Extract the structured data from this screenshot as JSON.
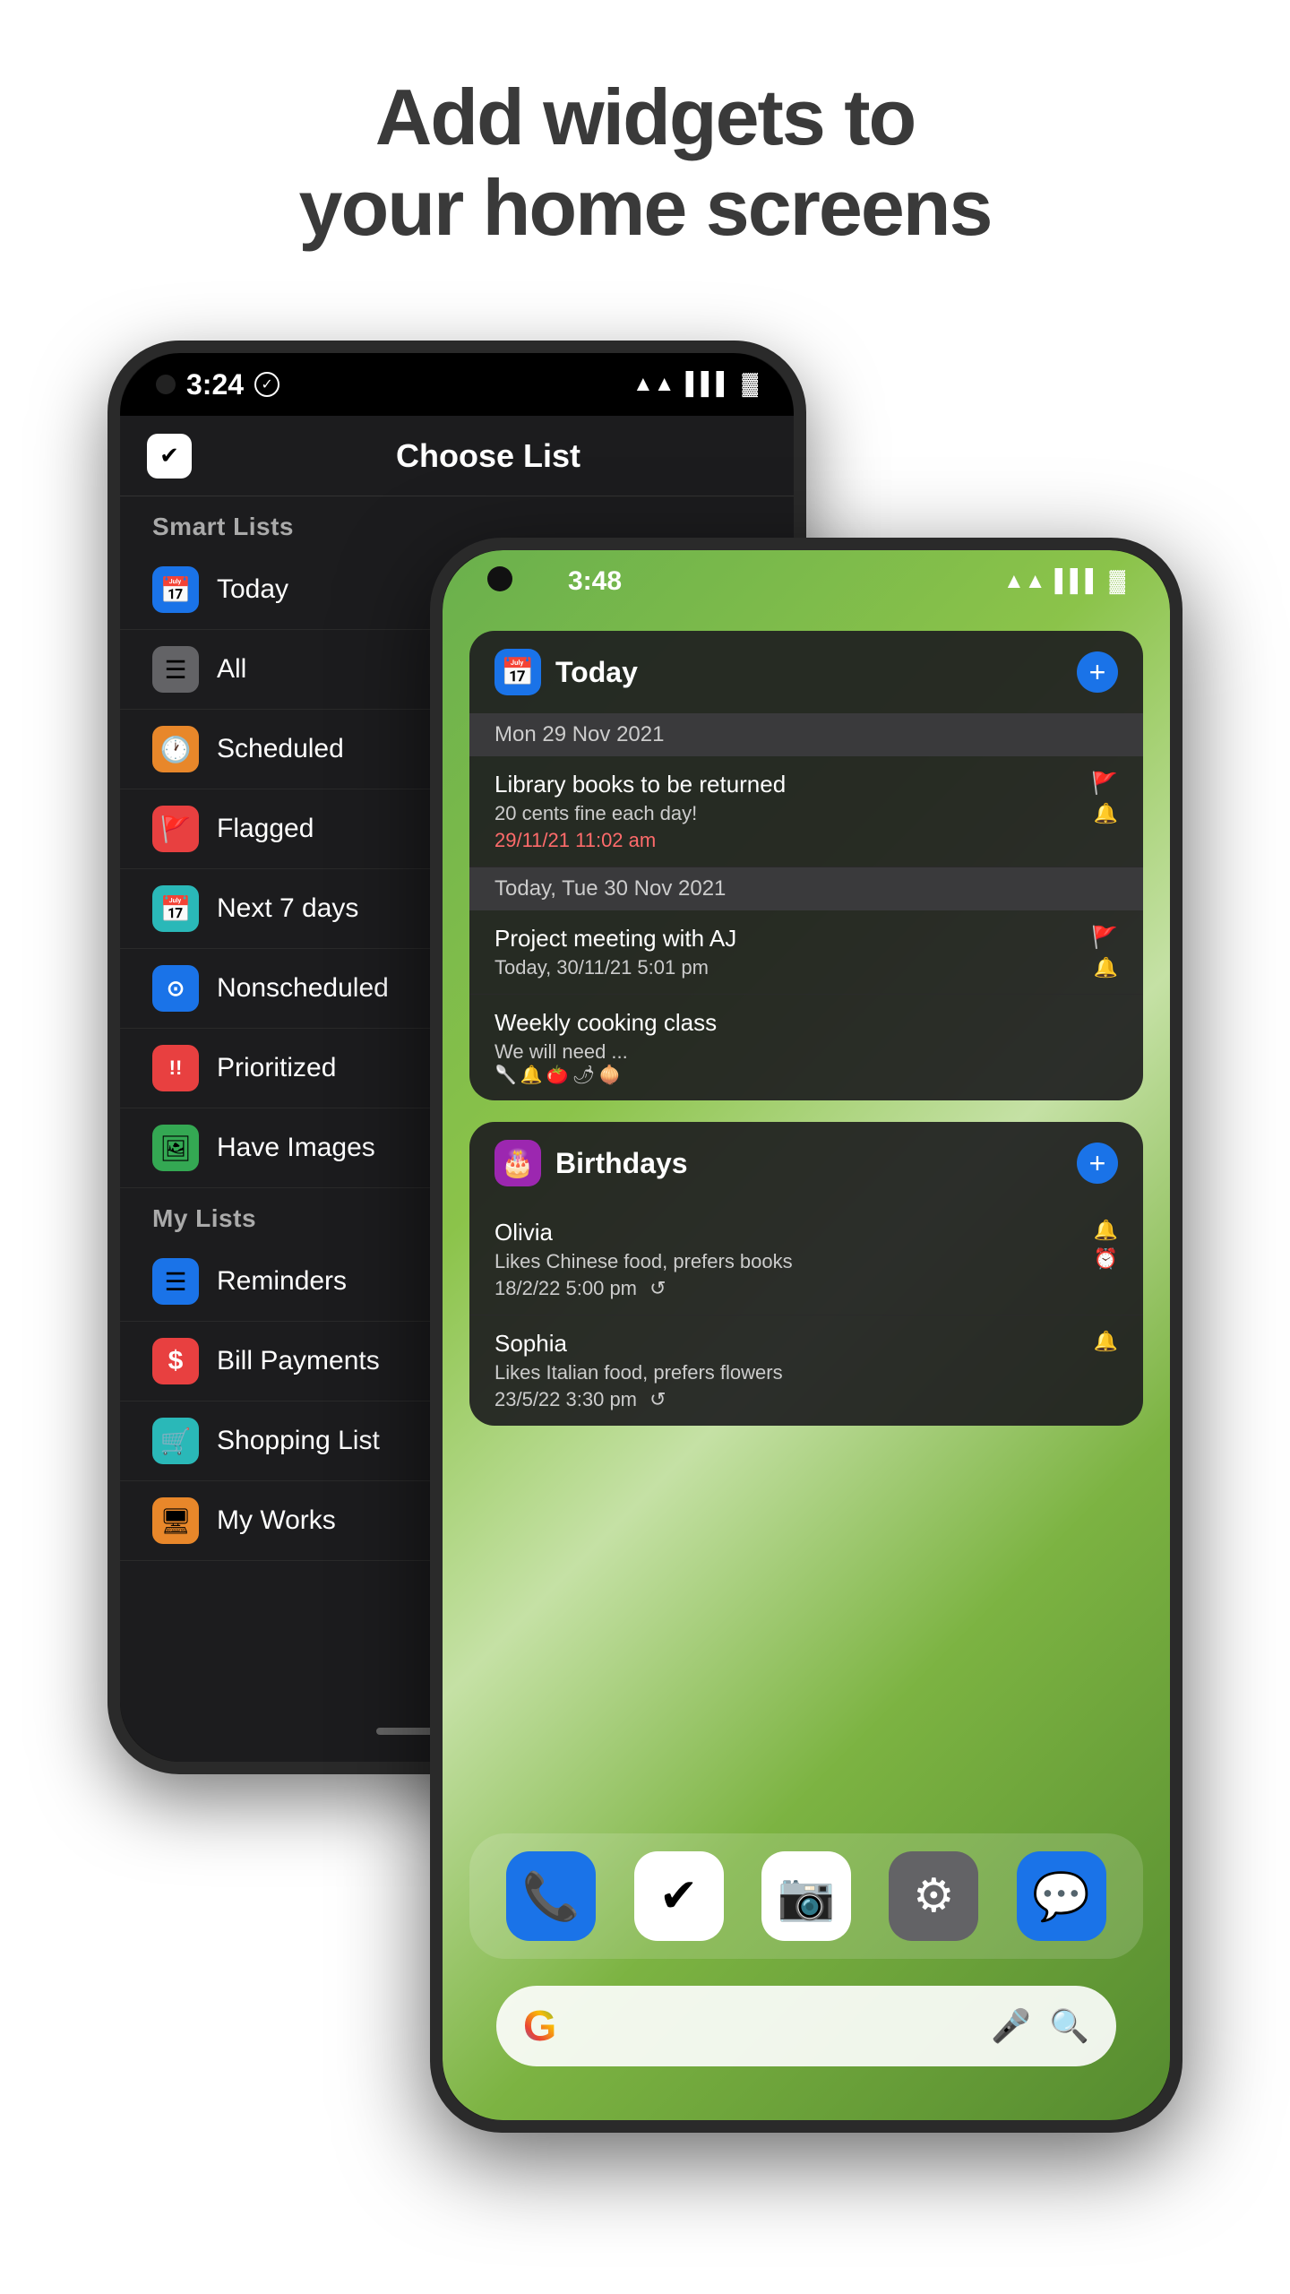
{
  "header": {
    "line1": "Add widgets to",
    "line2": "your home screens"
  },
  "phone_back": {
    "status": {
      "time": "3:24",
      "wifi": "▲",
      "signal": "▌▌▌",
      "battery": "🔋"
    },
    "toolbar_title": "Choose List",
    "smart_lists_header": "Smart Lists",
    "smart_lists": [
      {
        "icon": "📅",
        "icon_color": "icon-blue",
        "label": "Today"
      },
      {
        "icon": "☰",
        "icon_color": "icon-gray",
        "label": "All"
      },
      {
        "icon": "🕐",
        "icon_color": "icon-orange",
        "label": "Scheduled"
      },
      {
        "icon": "🚩",
        "icon_color": "icon-red-flag",
        "label": "Flagged"
      },
      {
        "icon": "📅",
        "icon_color": "icon-teal",
        "label": "Next 7 days"
      },
      {
        "icon": "⊙",
        "icon_color": "icon-blue-circle",
        "label": "Nonscheduled"
      },
      {
        "icon": "!!",
        "icon_color": "icon-red-exclaim",
        "label": "Prioritized"
      },
      {
        "icon": "🖼",
        "icon_color": "icon-green-img",
        "label": "Have Images"
      }
    ],
    "my_lists_header": "My Lists",
    "my_lists": [
      {
        "icon": "☰",
        "icon_color": "icon-blue-lines",
        "label": "Reminders"
      },
      {
        "icon": "$",
        "icon_color": "icon-red-dollar",
        "label": "Bill Payments"
      },
      {
        "icon": "🛒",
        "icon_color": "icon-teal-basket",
        "label": "Shopping List"
      },
      {
        "icon": "🖥",
        "icon_color": "icon-orange-monitor",
        "label": "My Works"
      }
    ]
  },
  "phone_front": {
    "status": {
      "time": "3:48",
      "wifi": "wifi",
      "signal": "signal",
      "battery": "battery"
    },
    "widget_today": {
      "title": "Today",
      "date_section1": "Mon 29 Nov 2021",
      "item1_title": "Library books to be returned",
      "item1_sub": "20 cents fine each day!",
      "item1_time": "29/11/21 11:02 am",
      "date_section2": "Today, Tue 30 Nov 2021",
      "item2_title": "Project meeting with AJ",
      "item2_sub": "Today, 30/11/21 5:01 pm",
      "item3_title": "Weekly cooking class",
      "item3_sub": "We will need ..."
    },
    "widget_birthdays": {
      "title": "Birthdays",
      "person1_name": "Olivia",
      "person1_desc": "Likes Chinese food, prefers books",
      "person1_date": "18/2/22 5:00 pm",
      "person2_name": "Sophia",
      "person2_desc": "Likes Italian food, prefers flowers",
      "person2_date": "23/5/22 3:30 pm"
    },
    "dock": {
      "phone_icon": "📞",
      "tasks_icon": "✓",
      "camera_icon": "📷",
      "settings_icon": "⚙",
      "messages_icon": "💬"
    },
    "search": {
      "google_g": "G",
      "mic": "🎤",
      "lens": "🔍"
    }
  }
}
